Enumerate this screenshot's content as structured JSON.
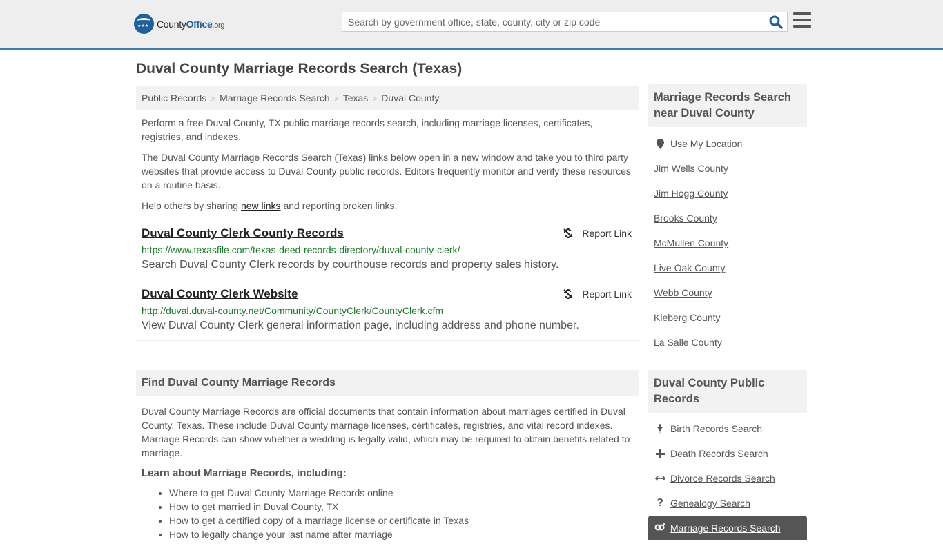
{
  "header": {
    "logo": {
      "brand_main": "County",
      "brand_accent": "Office",
      "brand_tld": ".org"
    },
    "search": {
      "placeholder": "Search by government office, state, county, city or zip code",
      "value": ""
    },
    "search_icon": "search-icon",
    "menu_icon": "hamburger-menu-icon"
  },
  "page": {
    "title": "Duval County Marriage Records Search (Texas)"
  },
  "breadcrumb": [
    "Public Records",
    "Marriage Records Search",
    "Texas",
    "Duval County"
  ],
  "intro": {
    "p1": "Perform a free Duval County, TX public marriage records search, including marriage licenses, certificates, registries, and indexes.",
    "p2": "The Duval County Marriage Records Search (Texas) links below open in a new window and take you to third party websites that provide access to Duval County public records. Editors frequently monitor and verify these resources on a routine basis.",
    "p3_before": "Help others by sharing ",
    "p3_link": "new links",
    "p3_after": " and reporting broken links."
  },
  "links": [
    {
      "title": "Duval County Clerk County Records",
      "url": "https://www.texasfile.com/texas-deed-records-directory/duval-county-clerk/",
      "description": "Search Duval County Clerk records by courthouse records and property sales history.",
      "report_label": "Report Link"
    },
    {
      "title": "Duval County Clerk Website",
      "url": "http://duval.duval-county.net/Community/CountyClerk/CountyClerk.cfm",
      "description": "View Duval County Clerk general information page, including address and phone number.",
      "report_label": "Report Link"
    }
  ],
  "find_section": {
    "heading": "Find Duval County Marriage Records",
    "body": "Duval County Marriage Records are official documents that contain information about marriages certified in Duval County, Texas. These include Duval County marriage licenses, certificates, registries, and vital record indexes. Marriage Records can show whether a wedding is legally valid, which may be required to obtain benefits related to marriage.",
    "subheading": "Learn about Marriage Records, including:",
    "items": [
      "Where to get Duval County Marriage Records online",
      "How to get married in Duval County, TX",
      "How to get a certified copy of a marriage license or certificate in Texas",
      "How to legally change your last name after marriage"
    ]
  },
  "sidebar": {
    "nearby": {
      "heading": "Marriage Records Search near Duval County",
      "location_label": "Use My Location",
      "counties": [
        "Jim Wells County",
        "Jim Hogg County",
        "Brooks County",
        "McMullen County",
        "Live Oak County",
        "Webb County",
        "Kleberg County",
        "La Salle County"
      ]
    },
    "public_records": {
      "heading": "Duval County Public Records",
      "items": [
        {
          "label": "Birth Records Search",
          "icon": "child-icon",
          "glyph": "🚶"
        },
        {
          "label": "Death Records Search",
          "icon": "plus-icon",
          "glyph": "✚"
        },
        {
          "label": "Divorce Records Search",
          "icon": "arrows-h-icon",
          "glyph": "↔"
        },
        {
          "label": "Genealogy Search",
          "icon": "question-icon",
          "glyph": "?"
        },
        {
          "label": "Marriage Records Search",
          "icon": "venus-mars-icon",
          "glyph": "⚤"
        }
      ]
    }
  },
  "colors": {
    "header_border": "#3a7cb0",
    "url_green": "#1a7a2a",
    "brand_blue": "#1f5f9c",
    "active_bg": "#555555"
  }
}
